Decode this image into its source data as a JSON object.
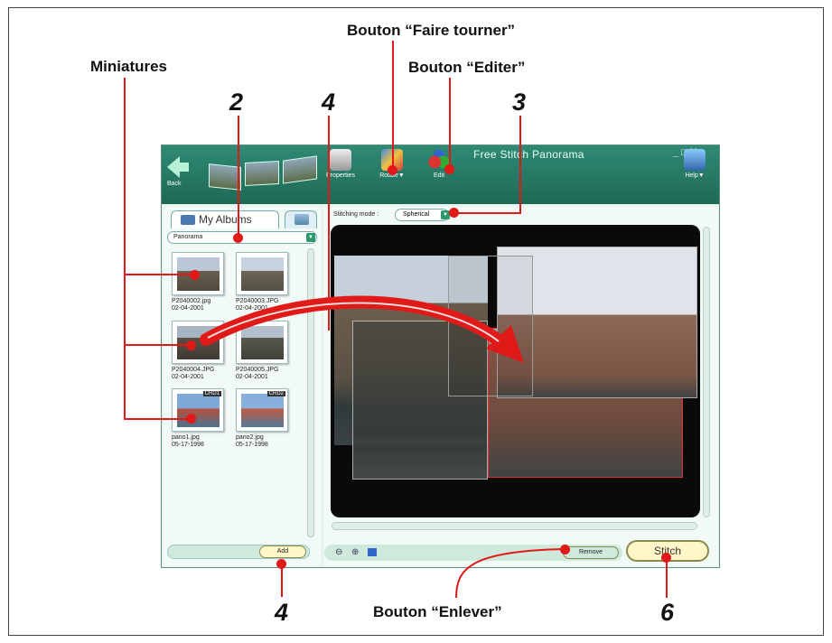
{
  "callouts": {
    "rotate_button": "Bouton “Faire tourner”",
    "edit_button": "Bouton “Editer”",
    "thumbnails": "Miniatures",
    "remove_button": "Bouton “Enlever”",
    "num_2": "2",
    "num_4_top": "4",
    "num_3": "3",
    "num_4_bottom": "4",
    "num_6": "6"
  },
  "window": {
    "title": "Free Stitch Panorama",
    "back_label": "Back",
    "toolbar": {
      "properties_label": "Properties",
      "rotate_label": "Rotate▼",
      "edit_label": "Edit",
      "help_label": "Help▼"
    },
    "controls": "_ □ X"
  },
  "left_pane": {
    "tab_label": "My Albums",
    "album_selected": "Panorama",
    "thumbnails": [
      {
        "name": "P2040002.jpg",
        "date": "02-04-2001"
      },
      {
        "name": "P2040003.JPG",
        "date": "02-04-2001"
      },
      {
        "name": "P2040004.JPG",
        "date": "02-04-2001"
      },
      {
        "name": "P2040005.JPG",
        "date": "02-04-2001"
      },
      {
        "name": "pano1.jpg",
        "date": "05-17-1998",
        "badge": "CRD1"
      },
      {
        "name": "pano2.jpg",
        "date": "05-17-1998",
        "badge": "CRD2"
      }
    ],
    "add_label": "Add"
  },
  "right_pane": {
    "stitching_mode_label": "Stitching mode :",
    "stitching_mode_value": "Spherical",
    "remove_label": "Remove",
    "stitch_label": "Stitch"
  },
  "colors": {
    "callout_red": "#e01919",
    "window_header": "#1e6956",
    "pane_bg": "#f2faf7"
  }
}
